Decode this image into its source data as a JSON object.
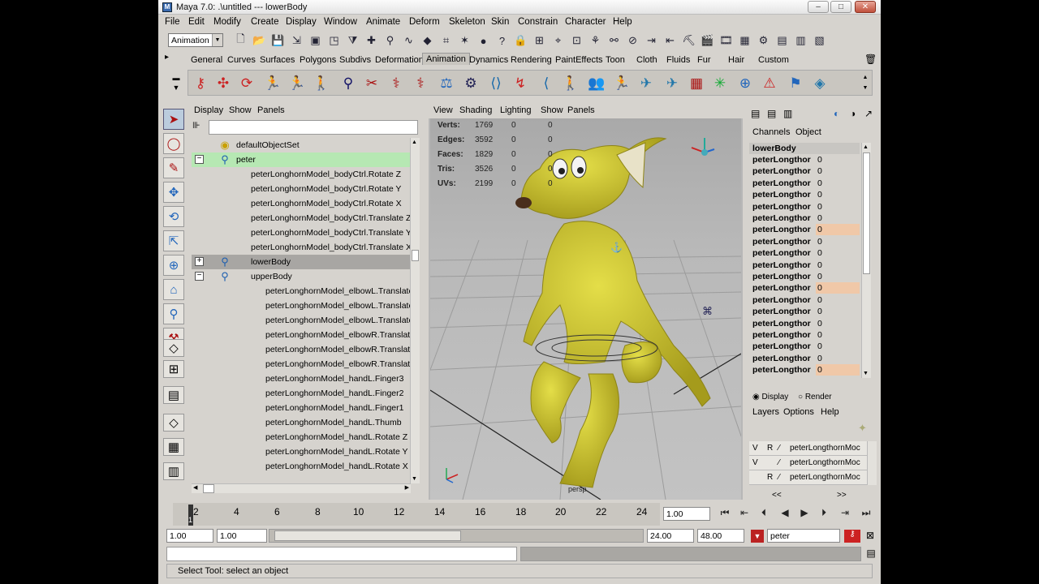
{
  "window": {
    "title": "Maya 7.0: .\\untitled   ---   lowerBody",
    "min": "–",
    "max": "□",
    "close": "✕"
  },
  "menu": [
    "File",
    "Edit",
    "Modify",
    "Create",
    "Display",
    "Window",
    "Animate",
    "Deform",
    "Skeleton",
    "Skin",
    "Constrain",
    "Character",
    "Help"
  ],
  "mode": "Animation",
  "shelf_tabs": [
    "General",
    "Curves",
    "Surfaces",
    "Polygons",
    "Subdivs",
    "Deformation",
    "Animation",
    "Dynamics",
    "Rendering",
    "PaintEffects",
    "Toon",
    "Cloth",
    "Fluids",
    "Fur",
    "Hair",
    "Custom"
  ],
  "active_tab": "Animation",
  "outliner": {
    "menu": [
      "Display",
      "Show",
      "Panels"
    ],
    "rows": [
      {
        "label": "defaultObjectSet",
        "indent": 0,
        "icon": "set-icon",
        "expander": "",
        "state": ""
      },
      {
        "label": "peter",
        "indent": 0,
        "icon": "character-icon",
        "expander": "⊟",
        "state": "highlight"
      },
      {
        "label": "peterLonghornModel_bodyCtrl.Rotate Z",
        "indent": 1,
        "icon": "",
        "expander": "",
        "state": ""
      },
      {
        "label": "peterLonghornModel_bodyCtrl.Rotate Y",
        "indent": 1,
        "icon": "",
        "expander": "",
        "state": ""
      },
      {
        "label": "peterLonghornModel_bodyCtrl.Rotate X",
        "indent": 1,
        "icon": "",
        "expander": "",
        "state": ""
      },
      {
        "label": "peterLonghornModel_bodyCtrl.Translate Z",
        "indent": 1,
        "icon": "",
        "expander": "",
        "state": ""
      },
      {
        "label": "peterLonghornModel_bodyCtrl.Translate Y",
        "indent": 1,
        "icon": "",
        "expander": "",
        "state": ""
      },
      {
        "label": "peterLonghornModel_bodyCtrl.Translate X",
        "indent": 1,
        "icon": "",
        "expander": "",
        "state": ""
      },
      {
        "label": "lowerBody",
        "indent": 1,
        "icon": "character-icon",
        "expander": "⊞",
        "state": "selected"
      },
      {
        "label": "upperBody",
        "indent": 1,
        "icon": "character-icon",
        "expander": "⊟",
        "state": ""
      },
      {
        "label": "peterLonghornModel_elbowL.Translate",
        "indent": 2,
        "icon": "",
        "expander": "",
        "state": ""
      },
      {
        "label": "peterLonghornModel_elbowL.Translate",
        "indent": 2,
        "icon": "",
        "expander": "",
        "state": ""
      },
      {
        "label": "peterLonghornModel_elbowL.Translate",
        "indent": 2,
        "icon": "",
        "expander": "",
        "state": ""
      },
      {
        "label": "peterLonghornModel_elbowR.Translate",
        "indent": 2,
        "icon": "",
        "expander": "",
        "state": ""
      },
      {
        "label": "peterLonghornModel_elbowR.Translate",
        "indent": 2,
        "icon": "",
        "expander": "",
        "state": ""
      },
      {
        "label": "peterLonghornModel_elbowR.Translate",
        "indent": 2,
        "icon": "",
        "expander": "",
        "state": ""
      },
      {
        "label": "peterLonghornModel_handL.Finger3",
        "indent": 2,
        "icon": "",
        "expander": "",
        "state": ""
      },
      {
        "label": "peterLonghornModel_handL.Finger2",
        "indent": 2,
        "icon": "",
        "expander": "",
        "state": ""
      },
      {
        "label": "peterLonghornModel_handL.Finger1",
        "indent": 2,
        "icon": "",
        "expander": "",
        "state": ""
      },
      {
        "label": "peterLonghornModel_handL.Thumb",
        "indent": 2,
        "icon": "",
        "expander": "",
        "state": ""
      },
      {
        "label": "peterLonghornModel_handL.Rotate Z",
        "indent": 2,
        "icon": "",
        "expander": "",
        "state": ""
      },
      {
        "label": "peterLonghornModel_handL.Rotate Y",
        "indent": 2,
        "icon": "",
        "expander": "",
        "state": ""
      },
      {
        "label": "peterLonghornModel_handL.Rotate X",
        "indent": 2,
        "icon": "",
        "expander": "",
        "state": ""
      }
    ]
  },
  "viewport": {
    "menu": [
      "View",
      "Shading",
      "Lighting",
      "Show",
      "Panels"
    ],
    "hud": [
      {
        "label": "Verts:",
        "a": "1769",
        "b": "0",
        "c": "0"
      },
      {
        "label": "Edges:",
        "a": "3592",
        "b": "0",
        "c": "0"
      },
      {
        "label": "Faces:",
        "a": "1829",
        "b": "0",
        "c": "0"
      },
      {
        "label": "Tris:",
        "a": "3526",
        "b": "0",
        "c": "0"
      },
      {
        "label": "UVs:",
        "a": "2199",
        "b": "0",
        "c": "0"
      }
    ],
    "camera": "persp"
  },
  "channels": {
    "tabs": [
      "Channels",
      "Object"
    ],
    "node": "lowerBody",
    "rows": [
      {
        "name": "peterLongthor",
        "value": "0",
        "keyed": false
      },
      {
        "name": "peterLongthor",
        "value": "0",
        "keyed": false
      },
      {
        "name": "peterLongthor",
        "value": "0",
        "keyed": false
      },
      {
        "name": "peterLongthor",
        "value": "0",
        "keyed": false
      },
      {
        "name": "peterLongthor",
        "value": "0",
        "keyed": false
      },
      {
        "name": "peterLongthor",
        "value": "0",
        "keyed": false
      },
      {
        "name": "peterLongthor",
        "value": "0",
        "keyed": true
      },
      {
        "name": "peterLongthor",
        "value": "0",
        "keyed": false
      },
      {
        "name": "peterLongthor",
        "value": "0",
        "keyed": false
      },
      {
        "name": "peterLongthor",
        "value": "0",
        "keyed": false
      },
      {
        "name": "peterLongthor",
        "value": "0",
        "keyed": false
      },
      {
        "name": "peterLongthor",
        "value": "0",
        "keyed": true
      },
      {
        "name": "peterLongthor",
        "value": "0",
        "keyed": false
      },
      {
        "name": "peterLongthor",
        "value": "0",
        "keyed": false
      },
      {
        "name": "peterLongthor",
        "value": "0",
        "keyed": false
      },
      {
        "name": "peterLongthor",
        "value": "0",
        "keyed": false
      },
      {
        "name": "peterLongthor",
        "value": "0",
        "keyed": false
      },
      {
        "name": "peterLongthor",
        "value": "0",
        "keyed": false
      },
      {
        "name": "peterLongthor",
        "value": "0",
        "keyed": true
      }
    ]
  },
  "layers": {
    "display": "Display",
    "render": "Render",
    "menu": [
      "Layers",
      "Options",
      "Help"
    ],
    "rows": [
      {
        "v": "V",
        "r": "R",
        "name": "peterLongthornMoc"
      },
      {
        "v": "V",
        "r": "",
        "name": "peterLongthornMoc"
      },
      {
        "v": "",
        "r": "R",
        "name": "peterLongthornMoc"
      }
    ],
    "scroll_left": "<<",
    "scroll_right": ">>"
  },
  "timeline": {
    "ticks": [
      "2",
      "4",
      "6",
      "8",
      "10",
      "12",
      "14",
      "16",
      "18",
      "20",
      "22",
      "24"
    ],
    "current_marker": "1",
    "current_frame": "1.00"
  },
  "range": {
    "start": "1.00",
    "inner_start": "1.00",
    "inner_end": "24.00",
    "end": "48.00",
    "character": "peter"
  },
  "help_line": "Select Tool: select an object"
}
